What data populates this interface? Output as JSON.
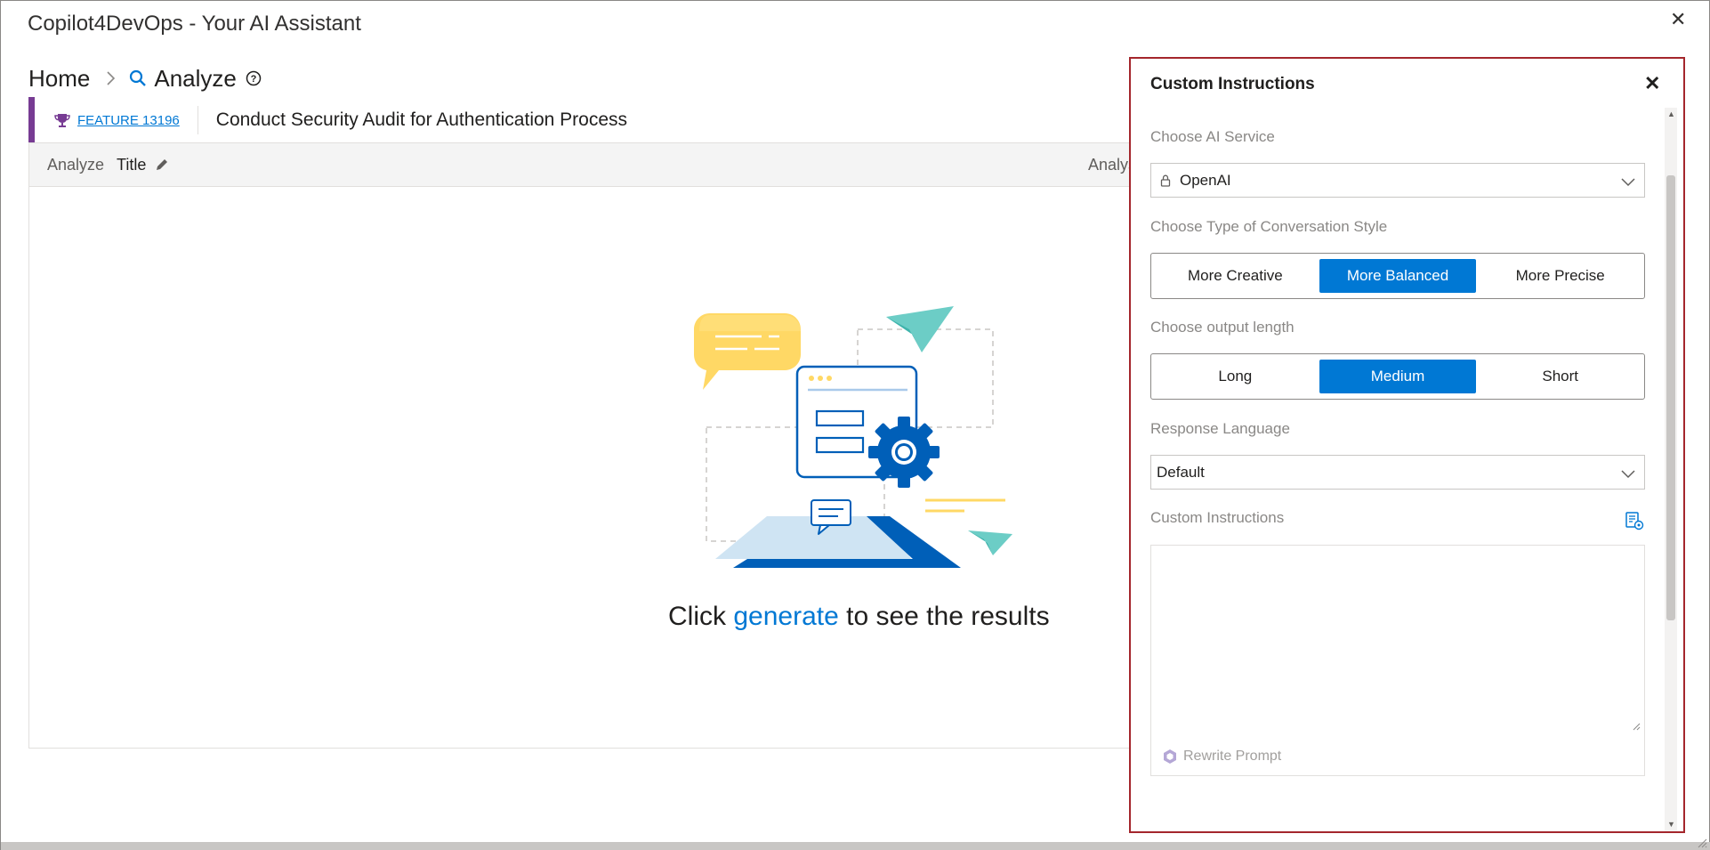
{
  "window": {
    "title": "Copilot4DevOps - Your AI Assistant",
    "close_glyph": "✕"
  },
  "breadcrumb": {
    "home": "Home",
    "current": "Analyze"
  },
  "work_item": {
    "type_link": "FEATURE 13196",
    "title": "Conduct Security Audit for Authentication Process",
    "accent_color": "#773b93"
  },
  "analyze": {
    "label": "Analyze",
    "title": "Title",
    "right_label": "Analys",
    "empty_prefix": "Click ",
    "empty_link": "generate",
    "empty_suffix": " to see the results"
  },
  "panel": {
    "title": "Custom Instructions",
    "close_glyph": "✕",
    "ai_service": {
      "label": "Choose AI Service",
      "value": "OpenAI"
    },
    "conversation_style": {
      "label": "Choose Type of Conversation Style",
      "options": [
        "More Creative",
        "More Balanced",
        "More Precise"
      ],
      "selected_index": 1
    },
    "output_length": {
      "label": "Choose output length",
      "options": [
        "Long",
        "Medium",
        "Short"
      ],
      "selected_index": 1
    },
    "response_language": {
      "label": "Response Language",
      "value": "Default"
    },
    "custom_instructions": {
      "label": "Custom Instructions",
      "value": "",
      "rewrite_label": "Rewrite Prompt"
    }
  },
  "colors": {
    "accent": "#0078d4",
    "panel_border": "#a4262c"
  },
  "icons": [
    "search-icon",
    "help-icon",
    "chevron-right-icon",
    "trophy-icon",
    "pencil-icon",
    "lock-icon",
    "chevron-down-icon",
    "template-icon",
    "rewrite-icon",
    "close-icon"
  ]
}
